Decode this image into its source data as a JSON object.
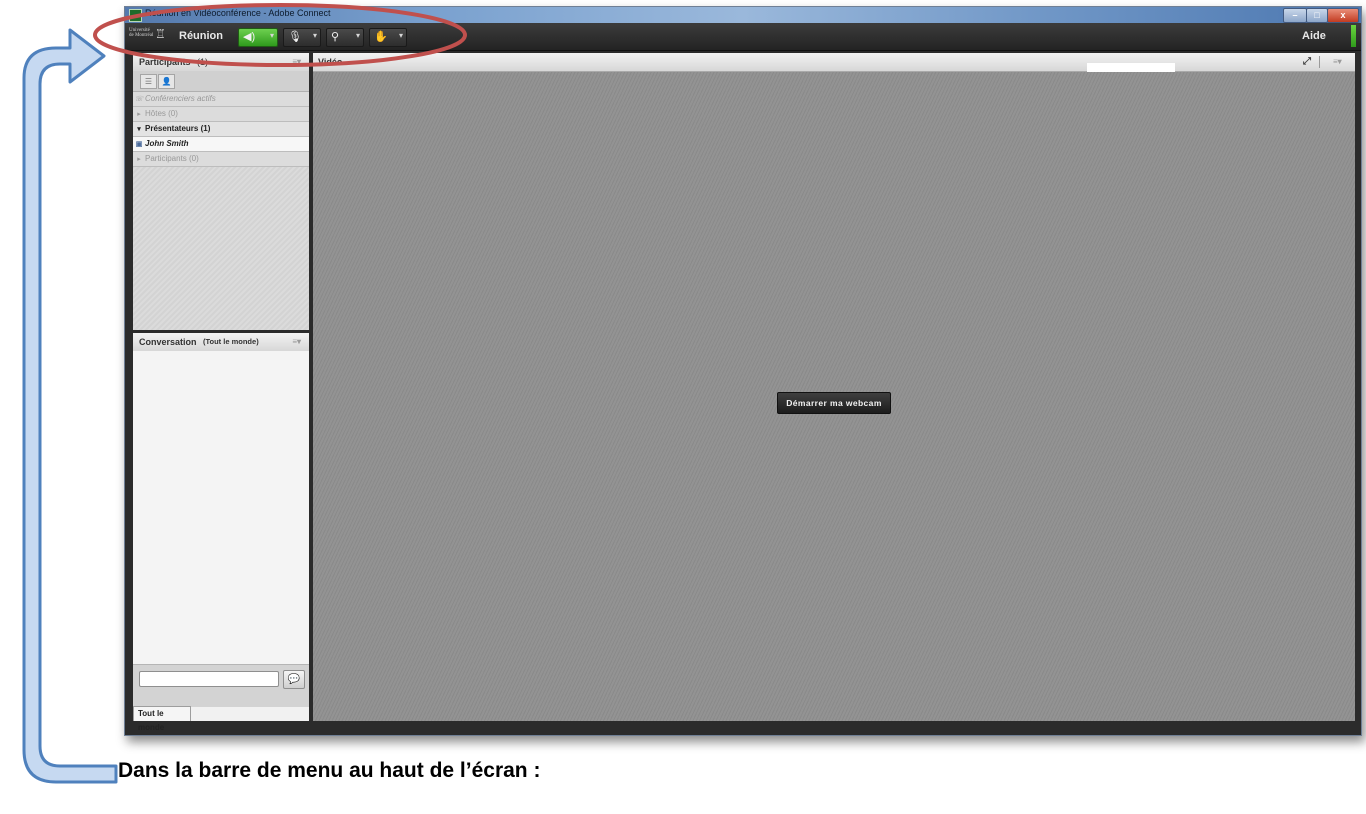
{
  "window": {
    "title": "Réunion en Vidéoconférence - Adobe Connect",
    "controls": {
      "minimize": "–",
      "maximize": "□",
      "close": "x"
    }
  },
  "menubar": {
    "logo_lines": [
      "Université",
      "de Montréal"
    ],
    "meeting_label": "Réunion",
    "help_label": "Aide",
    "speaker_icon": "speaker-icon",
    "mic_icon": "microphone-icon",
    "camera_icon": "webcam-icon",
    "status_icon": "raise-hand-icon"
  },
  "participants": {
    "title": "Participants",
    "count": "(1)",
    "active_speakers": "Conférenciers actifs",
    "groups": [
      {
        "label": "Hôtes (0)",
        "expanded": false
      },
      {
        "label": "Présentateurs (1)",
        "expanded": true
      },
      {
        "label": "Participants (0)",
        "expanded": false
      }
    ],
    "users": [
      "John Smith"
    ]
  },
  "conversation": {
    "title": "Conversation",
    "scope": "(Tout le monde)",
    "input_value": "",
    "tab_label": "Tout le monde"
  },
  "video": {
    "title": "Vidéo",
    "start_webcam_label": "Démarrer ma webcam"
  },
  "annotation": {
    "caption": "Dans la barre de menu au haut de l’écran :",
    "ellipse_color": "#c0504d",
    "arrow_color": "#4f81bd"
  }
}
